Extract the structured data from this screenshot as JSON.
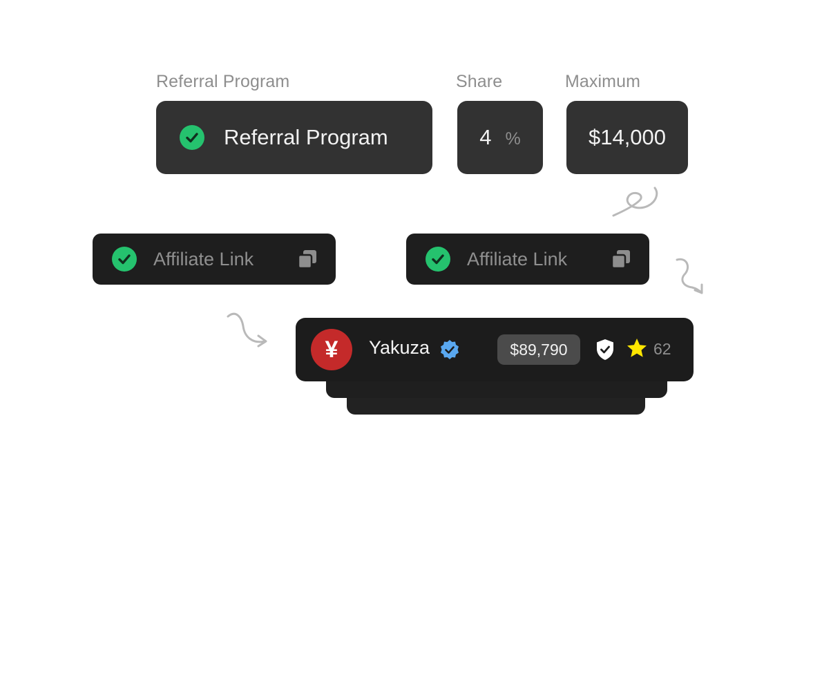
{
  "program": {
    "name_label": "Referral Program",
    "name_value": "Referral Program",
    "share_label": "Share",
    "share_value": "4",
    "share_unit": "%",
    "max_label": "Maximum",
    "max_value": "$14,000"
  },
  "affiliate_links": [
    {
      "label": "Affiliate Link"
    },
    {
      "label": "Affiliate Link"
    }
  ],
  "user": {
    "avatar_glyph": "¥",
    "name": "Yakuza",
    "balance": "$89,790",
    "rating": "62"
  },
  "colors": {
    "success": "#25c26e",
    "avatar": "#c42a2a",
    "verified": "#5aa8f0",
    "star": "#ffe600"
  },
  "icons": [
    "check-icon",
    "copy-icon",
    "verified-badge-icon",
    "shield-check-icon",
    "star-icon"
  ]
}
